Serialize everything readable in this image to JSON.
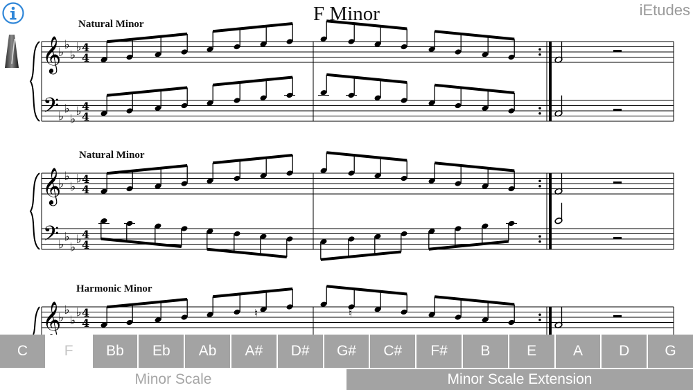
{
  "header": {
    "title": "F Minor",
    "brand": "iEtudes",
    "info_icon": "info-icon",
    "metronome_icon": "metronome-icon"
  },
  "score": {
    "sections": [
      {
        "label": "Natural Minor"
      },
      {
        "label": "Natural Minor"
      },
      {
        "label": "Harmonic Minor"
      }
    ]
  },
  "keys": {
    "selected": "F",
    "items": [
      "C",
      "F",
      "Bb",
      "Eb",
      "Ab",
      "A#",
      "D#",
      "G#",
      "C#",
      "F#",
      "B",
      "E",
      "A",
      "D",
      "G"
    ]
  },
  "modes": {
    "selected": "Minor Scale Extension",
    "items": [
      "Minor Scale",
      "Minor Scale Extension"
    ]
  },
  "colors": {
    "bar_gray": "#a3a3a3",
    "info_blue": "#2f86d8"
  }
}
